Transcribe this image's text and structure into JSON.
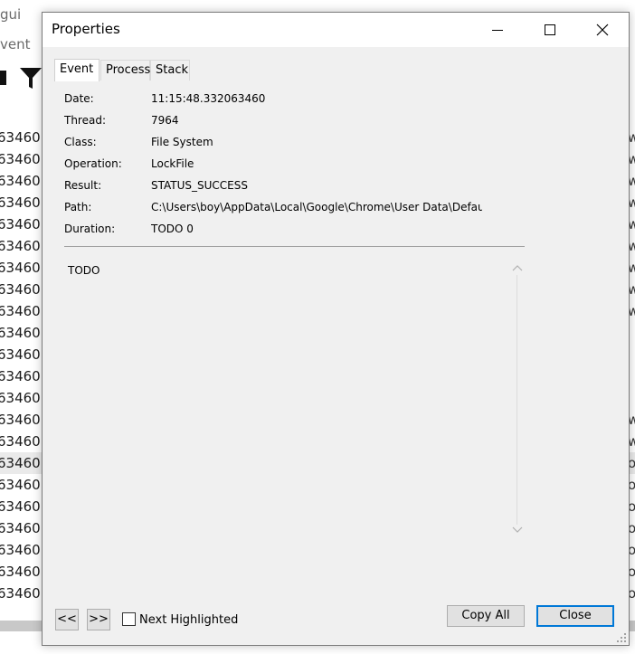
{
  "background": {
    "top_texts": [
      "gui",
      "vent"
    ],
    "rows": [
      "63460",
      "63460",
      "63460",
      "63460",
      "63460",
      "63460",
      "63460",
      "63460",
      "63460",
      "63460",
      "63460",
      "63460",
      "63460",
      "63460",
      "63460",
      "63460",
      "63460",
      "63460",
      "63460",
      "63460",
      "63460",
      "63460"
    ],
    "right_chars": [
      "w",
      "w",
      "w",
      "w",
      "w",
      "w",
      "w",
      "w",
      "w",
      "",
      "",
      "",
      "",
      "w",
      "w",
      "o",
      "o",
      "o",
      "o",
      "o",
      "o",
      "o"
    ]
  },
  "dialog": {
    "title": "Properties",
    "tabs": [
      "Event",
      "Process",
      "Stack"
    ],
    "active_tab": "Event",
    "fields": [
      {
        "label": "Date:",
        "value": "11:15:48.332063460"
      },
      {
        "label": "Thread:",
        "value": "7964"
      },
      {
        "label": "Class:",
        "value": "File System"
      },
      {
        "label": "Operation:",
        "value": "LockFile"
      },
      {
        "label": "Result:",
        "value": "STATUS_SUCCESS"
      },
      {
        "label": "Path:",
        "value": "C:\\Users\\boy\\AppData\\Local\\Google\\Chrome\\User Data\\Default\\"
      },
      {
        "label": "Duration:",
        "value": "TODO 0"
      }
    ],
    "detail_text": "TODO",
    "prev_label": "<<",
    "next_label": ">>",
    "next_highlighted_label": "Next Highlighted",
    "next_highlighted_checked": false,
    "copy_all_label": "Copy All",
    "close_label": "Close"
  }
}
